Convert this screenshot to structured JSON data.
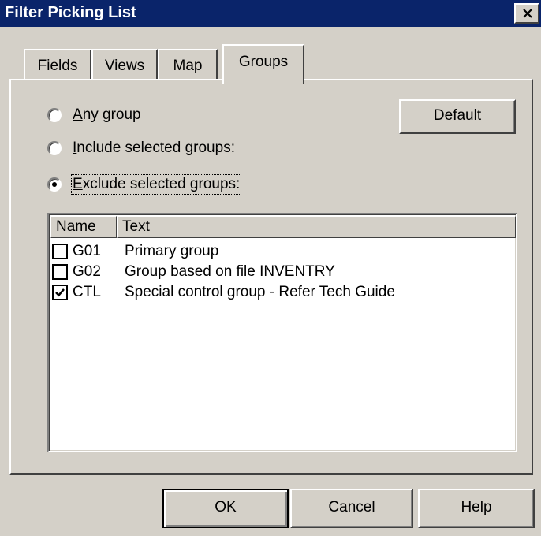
{
  "window": {
    "title": "Filter Picking List"
  },
  "tabs": [
    {
      "label": "Fields",
      "active": false
    },
    {
      "label": "Views",
      "active": false
    },
    {
      "label": "Map",
      "active": false
    },
    {
      "label": "Groups",
      "active": true
    }
  ],
  "radios": [
    {
      "mnemonic": "A",
      "rest": "ny group",
      "checked": false
    },
    {
      "mnemonic": "I",
      "rest": "nclude selected groups:",
      "checked": false
    },
    {
      "mnemonic": "E",
      "rest": "xclude selected groups:",
      "checked": true
    }
  ],
  "default_button": {
    "mnemonic": "D",
    "rest": "efault"
  },
  "list": {
    "columns": [
      "Name",
      "Text"
    ],
    "rows": [
      {
        "checked": false,
        "name": "G01",
        "text": "Primary group"
      },
      {
        "checked": false,
        "name": "G02",
        "text": "Group based on file INVENTRY"
      },
      {
        "checked": true,
        "name": "CTL",
        "text": "Special control group - Refer Tech Guide"
      }
    ]
  },
  "buttons": {
    "ok": "OK",
    "cancel": "Cancel",
    "help": "Help"
  },
  "icons": {
    "close": "close-icon",
    "check": "checkmark-icon"
  }
}
